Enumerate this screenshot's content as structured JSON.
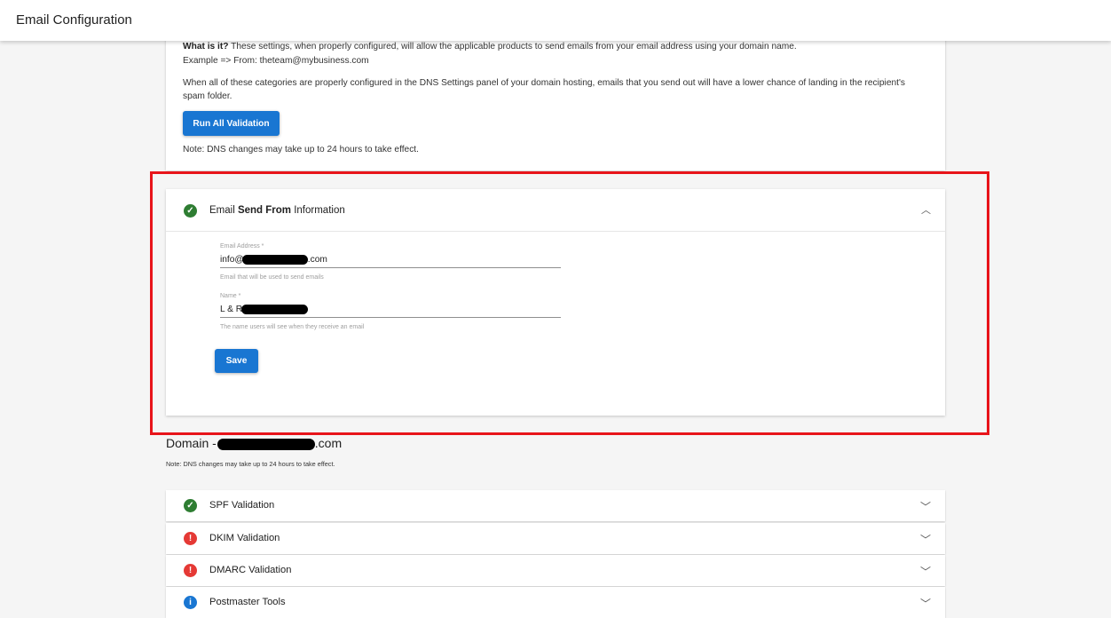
{
  "header": {
    "title": "Email Configuration"
  },
  "intro": {
    "what_label": "What is it?",
    "what_text": " These settings, when properly configured, will allow the applicable products to send emails from your email address using your domain name.",
    "example": "Example => From: theteam@mybusiness.com",
    "paragraph": "When all of these categories are properly configured in the DNS Settings panel of your domain hosting, emails that you send out will have a lower chance of landing in the recipient's spam folder.",
    "run_button": "Run All Validation",
    "note": "Note: DNS changes may take up to 24 hours to take effect."
  },
  "send_from": {
    "title_part1": "Email ",
    "title_bold": "Send From",
    "title_part2": " Information",
    "email_label": "Email Address *",
    "email_prefix": "info@",
    "email_suffix": ".com",
    "email_help": "Email that will be used to send emails",
    "name_label": "Name *",
    "name_prefix": "L & R",
    "name_help": "The name users will see when they receive an email",
    "save_button": "Save"
  },
  "domain": {
    "title_prefix": "Domain -",
    "title_suffix": ".com",
    "note": "Note: DNS changes may take up to 24 hours to take effect."
  },
  "validations": [
    {
      "label": "SPF Validation",
      "status": "success"
    },
    {
      "label": "DKIM Validation",
      "status": "error"
    },
    {
      "label": "DMARC Validation",
      "status": "error"
    },
    {
      "label": "Postmaster Tools",
      "status": "info"
    }
  ],
  "colors": {
    "primary": "#1976d2",
    "success": "#2e7d32",
    "error": "#e53935",
    "highlight": "#e8141a"
  },
  "icons": {
    "success": "check-circle-icon",
    "error": "error-circle-icon",
    "info": "info-circle-icon",
    "expand": "chevron-down-icon",
    "collapse": "chevron-up-icon"
  }
}
